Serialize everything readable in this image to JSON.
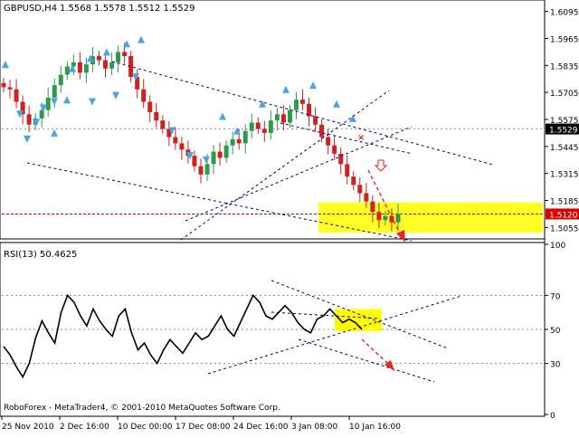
{
  "chart_data": [
    {
      "type": "candlestick",
      "header": {
        "symbol": "GBPUSD,H4",
        "ohlc": "1.5568 1.5578 1.5512 1.5529"
      },
      "y_ticks": [
        1.6095,
        1.5965,
        1.5835,
        1.5705,
        1.5575,
        1.5445,
        1.5315,
        1.5185,
        1.5055
      ],
      "y_tick_labels": [
        "1.6095",
        "1.5965",
        "1.5835",
        "1.5705",
        "1.5575",
        "1.5445",
        "1.5315",
        "1.5185",
        "1.5055"
      ],
      "ylim": [
        1.5,
        1.615
      ],
      "current_price_label": "1.5529",
      "target_level_label": "1.5120",
      "colors": {
        "bull": "#2e9a4e",
        "bear": "#cc2222",
        "fractal": "#4aa3e8",
        "channel": "#00008b",
        "target_line": "#dd0000",
        "highlight": "#ffff00"
      },
      "approx_series_note_values": [
        1.573,
        1.572,
        1.566,
        1.56,
        1.555,
        1.558,
        1.562,
        1.568,
        1.574,
        1.579,
        1.583,
        1.585,
        1.58,
        1.584,
        1.588,
        1.586,
        1.582,
        1.585,
        1.59,
        1.588,
        1.578,
        1.572,
        1.566,
        1.561,
        1.557,
        1.553,
        1.549,
        1.546,
        1.543,
        1.54,
        1.535,
        1.531,
        1.536,
        1.542,
        1.539,
        1.545,
        1.548,
        1.546,
        1.552,
        1.556,
        1.553,
        1.551,
        1.557,
        1.56,
        1.556,
        1.562,
        1.567,
        1.565,
        1.559,
        1.555,
        1.549,
        1.545,
        1.541,
        1.536,
        1.53,
        1.526,
        1.522,
        1.518,
        1.513,
        1.509,
        1.511,
        1.508,
        1.512
      ]
    },
    {
      "type": "line",
      "title": "RSI(13) 50.4625",
      "y_ticks": [
        100,
        70,
        50,
        30,
        0
      ],
      "y_tick_labels": [
        "100",
        "70",
        "50",
        "30",
        "0"
      ],
      "ylim": [
        0,
        100
      ],
      "values": [
        40,
        35,
        28,
        22,
        30,
        45,
        55,
        48,
        42,
        60,
        70,
        66,
        58,
        52,
        62,
        55,
        50,
        46,
        58,
        62,
        48,
        38,
        42,
        35,
        30,
        38,
        44,
        40,
        36,
        42,
        48,
        44,
        46,
        52,
        58,
        50,
        46,
        54,
        62,
        70,
        66,
        58,
        56,
        60,
        64,
        60,
        54,
        50,
        48,
        56,
        58,
        62,
        58,
        54,
        56,
        54,
        50
      ]
    }
  ],
  "x_tick_labels": [
    "25 Nov 2010",
    "2 Dec 16:00",
    "10 Dec 00:00",
    "17 Dec 08:00",
    "24 Dec 16:00",
    "3 Jan 08:00",
    "10 Jan 16:00"
  ],
  "footer": "RoboForex - MetaTrader4, © 2001-2010 MetaQuotes Software Corp."
}
